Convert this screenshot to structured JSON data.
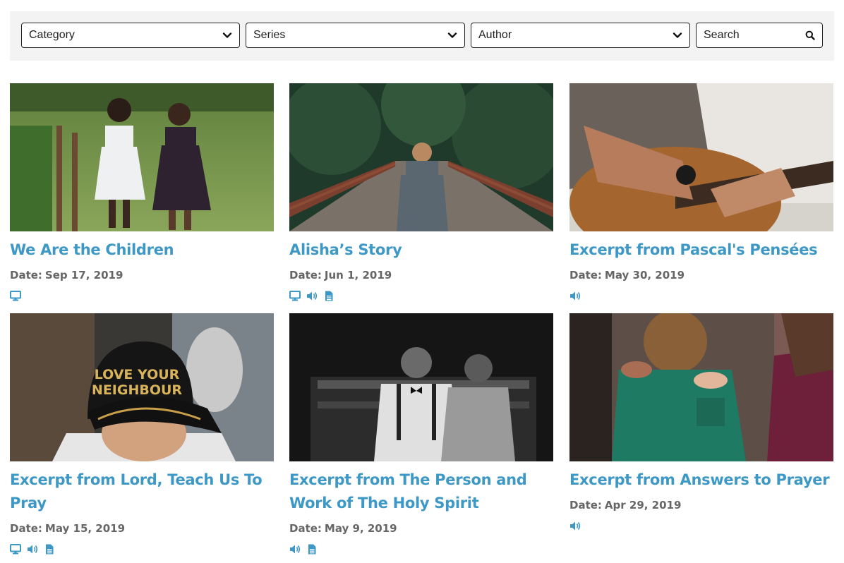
{
  "filters": {
    "category_label": "Category",
    "series_label": "Series",
    "author_label": "Author",
    "search_placeholder": "Search"
  },
  "date_prefix": "Date:",
  "cards": [
    {
      "title": "We Are the Children",
      "date": "Sep 17, 2019",
      "media": [
        "video"
      ]
    },
    {
      "title": "Alisha’s Story",
      "date": "Jun 1, 2019",
      "media": [
        "video",
        "audio",
        "document"
      ]
    },
    {
      "title": "Excerpt from Pascal's Pensées",
      "date": "May 30, 2019",
      "media": [
        "audio"
      ]
    },
    {
      "title": "Excerpt from Lord, Teach Us To Pray",
      "date": "May 15, 2019",
      "media": [
        "video",
        "audio",
        "document"
      ]
    },
    {
      "title": "Excerpt from The Person and Work of The Holy Spirit",
      "date": "May 9, 2019",
      "media": [
        "audio",
        "document"
      ]
    },
    {
      "title": "Excerpt from Answers to Prayer",
      "date": "Apr 29, 2019",
      "media": [
        "audio"
      ]
    }
  ],
  "cap_text": {
    "line1": "LOVE YOUR",
    "line2": "NEIGHBOUR"
  },
  "colors": {
    "accent": "#3d98c6",
    "date": "#666666",
    "filter_bg": "#f3f3f3"
  }
}
